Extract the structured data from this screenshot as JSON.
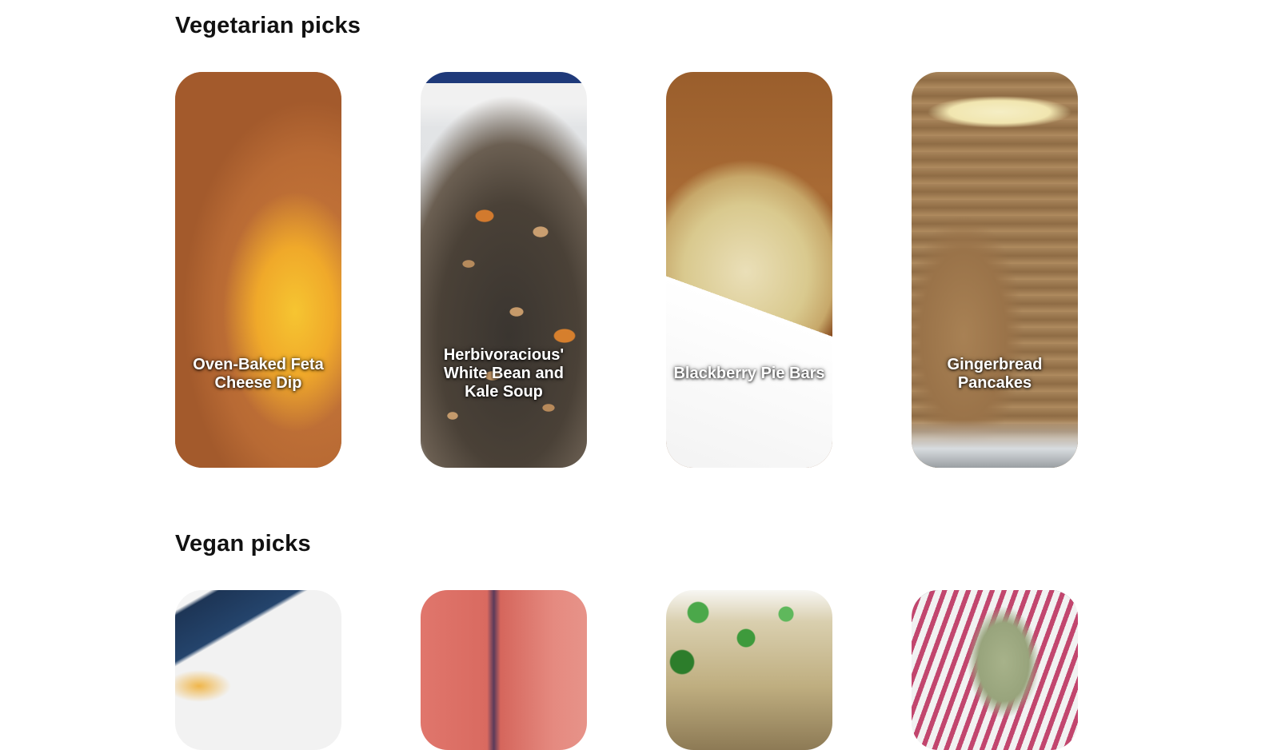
{
  "sections": [
    {
      "title": "Vegetarian picks",
      "cards": [
        {
          "title": "Oven-Baked Feta Cheese Dip"
        },
        {
          "title": "Herbivoracious' White Bean and Kale Soup"
        },
        {
          "title": "Blackberry Pie Bars"
        },
        {
          "title": "Gingerbread Pancakes"
        }
      ]
    },
    {
      "title": "Vegan picks",
      "cards": [
        {
          "title": ""
        },
        {
          "title": ""
        },
        {
          "title": ""
        },
        {
          "title": ""
        }
      ]
    }
  ]
}
